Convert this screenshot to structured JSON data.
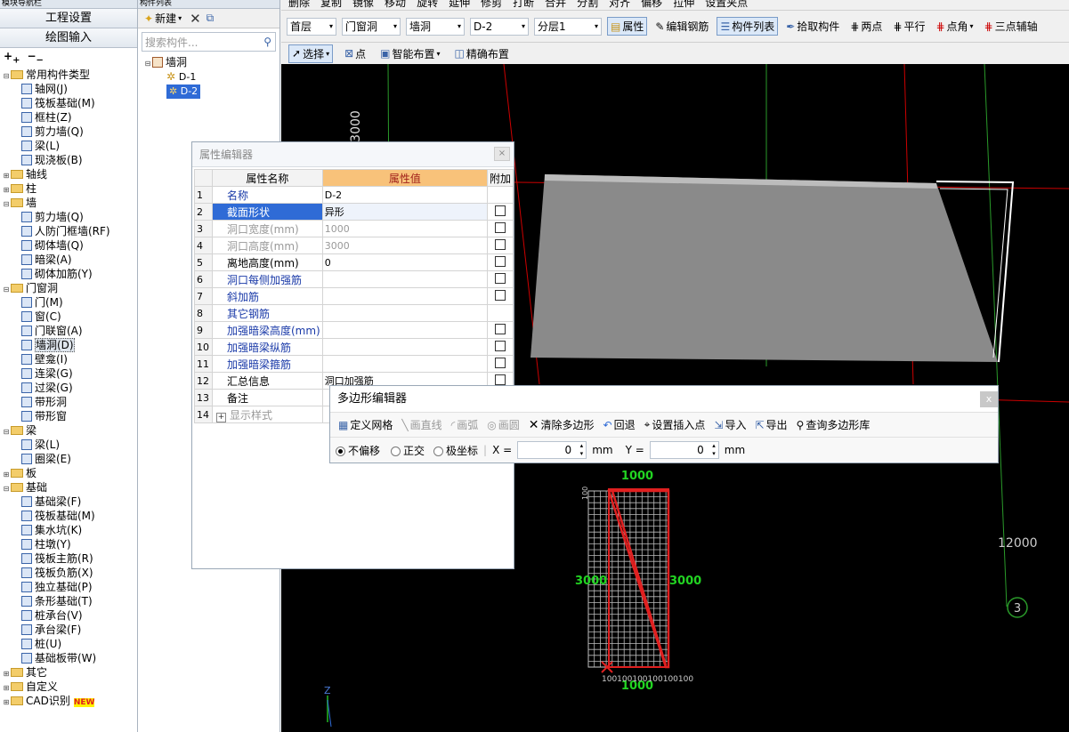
{
  "left_panel": {
    "header": "模块导航栏",
    "btn_settings": "工程设置",
    "btn_drawing": "绘图输入",
    "tree": [
      {
        "type": "folder",
        "label": "常用构件类型",
        "open": true,
        "level": 0
      },
      {
        "type": "item",
        "label": "轴网(J)",
        "level": 1
      },
      {
        "type": "item",
        "label": "筏板基础(M)",
        "level": 1
      },
      {
        "type": "item",
        "label": "框柱(Z)",
        "level": 1
      },
      {
        "type": "item",
        "label": "剪力墙(Q)",
        "level": 1
      },
      {
        "type": "item",
        "label": "梁(L)",
        "level": 1
      },
      {
        "type": "item",
        "label": "现浇板(B)",
        "level": 1
      },
      {
        "type": "folder",
        "label": "轴线",
        "open": false,
        "level": 0
      },
      {
        "type": "folder",
        "label": "柱",
        "open": false,
        "level": 0
      },
      {
        "type": "folder",
        "label": "墙",
        "open": true,
        "level": 0
      },
      {
        "type": "item",
        "label": "剪力墙(Q)",
        "level": 1
      },
      {
        "type": "item",
        "label": "人防门框墙(RF)",
        "level": 1
      },
      {
        "type": "item",
        "label": "砌体墙(Q)",
        "level": 1
      },
      {
        "type": "item",
        "label": "暗梁(A)",
        "level": 1
      },
      {
        "type": "item",
        "label": "砌体加筋(Y)",
        "level": 1
      },
      {
        "type": "folder",
        "label": "门窗洞",
        "open": true,
        "level": 0
      },
      {
        "type": "item",
        "label": "门(M)",
        "level": 1
      },
      {
        "type": "item",
        "label": "窗(C)",
        "level": 1
      },
      {
        "type": "item",
        "label": "门联窗(A)",
        "level": 1
      },
      {
        "type": "item",
        "label": "墙洞(D)",
        "level": 1,
        "selected": true
      },
      {
        "type": "item",
        "label": "壁龛(I)",
        "level": 1
      },
      {
        "type": "item",
        "label": "连梁(G)",
        "level": 1
      },
      {
        "type": "item",
        "label": "过梁(G)",
        "level": 1
      },
      {
        "type": "item",
        "label": "带形洞",
        "level": 1
      },
      {
        "type": "item",
        "label": "带形窗",
        "level": 1
      },
      {
        "type": "folder",
        "label": "梁",
        "open": true,
        "level": 0
      },
      {
        "type": "item",
        "label": "梁(L)",
        "level": 1
      },
      {
        "type": "item",
        "label": "圈梁(E)",
        "level": 1
      },
      {
        "type": "folder",
        "label": "板",
        "open": false,
        "level": 0
      },
      {
        "type": "folder",
        "label": "基础",
        "open": true,
        "level": 0
      },
      {
        "type": "item",
        "label": "基础梁(F)",
        "level": 1
      },
      {
        "type": "item",
        "label": "筏板基础(M)",
        "level": 1
      },
      {
        "type": "item",
        "label": "集水坑(K)",
        "level": 1
      },
      {
        "type": "item",
        "label": "柱墩(Y)",
        "level": 1
      },
      {
        "type": "item",
        "label": "筏板主筋(R)",
        "level": 1
      },
      {
        "type": "item",
        "label": "筏板负筋(X)",
        "level": 1
      },
      {
        "type": "item",
        "label": "独立基础(P)",
        "level": 1
      },
      {
        "type": "item",
        "label": "条形基础(T)",
        "level": 1
      },
      {
        "type": "item",
        "label": "桩承台(V)",
        "level": 1
      },
      {
        "type": "item",
        "label": "承台梁(F)",
        "level": 1
      },
      {
        "type": "item",
        "label": "桩(U)",
        "level": 1
      },
      {
        "type": "item",
        "label": "基础板带(W)",
        "level": 1
      },
      {
        "type": "folder",
        "label": "其它",
        "open": false,
        "level": 0
      },
      {
        "type": "folder",
        "label": "自定义",
        "open": false,
        "level": 0
      },
      {
        "type": "folder",
        "label": "CAD识别",
        "open": false,
        "level": 0,
        "badge": "NEW"
      }
    ]
  },
  "mid_panel": {
    "header": "构件列表",
    "new_label": "新建",
    "search_placeholder": "搜索构件...",
    "root": "墙洞",
    "items": [
      "D-1",
      "D-2"
    ],
    "selected": "D-2"
  },
  "top_toolbar": {
    "row0": [
      "删除",
      "复制",
      "镜像",
      "移动",
      "旋转",
      "延伸",
      "修剪",
      "打断",
      "合并",
      "分割",
      "对齐",
      "偏移",
      "拉伸",
      "设置夹点"
    ],
    "floor": "首层",
    "category": "门窗洞",
    "type": "墙洞",
    "component": "D-2",
    "layer": "分层1",
    "btn_property": "属性",
    "btn_edit_rebar": "编辑钢筋",
    "btn_component_list": "构件列表",
    "btn_pick": "拾取构件",
    "btn_two_points": "两点",
    "btn_parallel": "平行",
    "btn_point_angle": "点角",
    "btn_three_points": "三点辅轴",
    "btn_select": "选择",
    "btn_point": "点",
    "btn_smart": "智能布置",
    "btn_precise": "精确布置"
  },
  "prop_editor": {
    "title": "属性编辑器",
    "col_name": "属性名称",
    "col_value": "属性值",
    "col_extra": "附加",
    "rows": [
      {
        "n": "1",
        "name": "名称",
        "value": "D-2",
        "cb": false,
        "style": "blue"
      },
      {
        "n": "2",
        "name": "截面形状",
        "value": "异形",
        "cb": true,
        "style": "blue",
        "selected": true
      },
      {
        "n": "3",
        "name": "洞口宽度(mm)",
        "value": "1000",
        "cb": true,
        "style": "gray"
      },
      {
        "n": "4",
        "name": "洞口高度(mm)",
        "value": "3000",
        "cb": true,
        "style": "gray"
      },
      {
        "n": "5",
        "name": "离地高度(mm)",
        "value": "0",
        "cb": true,
        "style": "normal"
      },
      {
        "n": "6",
        "name": "洞口每侧加强筋",
        "value": "",
        "cb": true,
        "style": "blue"
      },
      {
        "n": "7",
        "name": "斜加筋",
        "value": "",
        "cb": true,
        "style": "blue"
      },
      {
        "n": "8",
        "name": "其它钢筋",
        "value": "",
        "cb": false,
        "style": "blue"
      },
      {
        "n": "9",
        "name": "加强暗梁高度(mm)",
        "value": "",
        "cb": true,
        "style": "blue"
      },
      {
        "n": "10",
        "name": "加强暗梁纵筋",
        "value": "",
        "cb": true,
        "style": "blue"
      },
      {
        "n": "11",
        "name": "加强暗梁箍筋",
        "value": "",
        "cb": true,
        "style": "blue"
      },
      {
        "n": "12",
        "name": "汇总信息",
        "value": "洞口加强筋",
        "cb": true,
        "style": "normal"
      },
      {
        "n": "13",
        "name": "备注",
        "value": "",
        "cb": false,
        "style": "normal"
      },
      {
        "n": "14",
        "name": "显示样式",
        "value": "",
        "cb": false,
        "style": "gray",
        "expand": "+"
      }
    ]
  },
  "poly_editor": {
    "title": "多边形编辑器",
    "close": "x",
    "tools": [
      "定义网格",
      "画直线",
      "画弧",
      "画圆",
      "清除多边形",
      "回退",
      "设置插入点",
      "导入",
      "导出",
      "查询多边形库"
    ],
    "mode_none": "不偏移",
    "mode_ortho": "正交",
    "mode_polar": "极坐标",
    "x_label": "X =",
    "x_value": "0",
    "y_label": "Y =",
    "y_value": "0",
    "unit": "mm"
  },
  "canvas": {
    "dim_3000_top": "3000",
    "dim_12000": "12000",
    "axis_label": "3",
    "z_label": "Z",
    "grid_width_top": "1000",
    "grid_width_bottom": "1000",
    "grid_height_left": "3000",
    "grid_height_right": "3000",
    "tick_label": "100",
    "bottom_ticks": "100100100100100100"
  }
}
